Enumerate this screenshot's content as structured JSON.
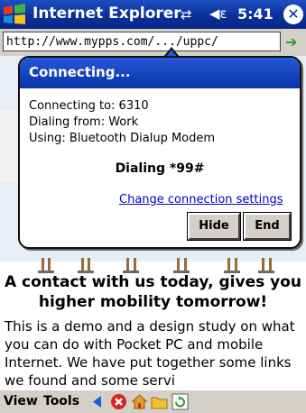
{
  "title_bar": {
    "app_title": "Internet Explorer",
    "clock": "5:41",
    "connectivity_glyph": "⇄",
    "volume_glyph": "◀ε",
    "close_glyph": "✕",
    "icons": [
      "windows-start-icon",
      "connectivity-icon",
      "volume-icon",
      "close-icon"
    ]
  },
  "address_bar": {
    "url": "http://www.mypps.com/.../uppc/"
  },
  "page": {
    "headline": "A contact with us today, gives you higher mobility tomorrow!",
    "body": "This is a demo and a design study on what you can do with Pocket PC and mobile Internet. We have put together some links we found and some servi"
  },
  "dialog": {
    "title": "Connecting...",
    "connecting_to": "Connecting to:   6310",
    "dialing_from": "Dialing from: Work",
    "using": "Using: Bluetooth Dialup Modem",
    "status": "Dialing *99#",
    "change_link": "Change connection settings",
    "hide_button": "Hide",
    "end_button": "End"
  },
  "toolbar": {
    "view_label": "View",
    "tools_label": "Tools",
    "icons": [
      "back-icon",
      "stop-icon",
      "home-icon",
      "favorites-icon",
      "refresh-icon"
    ]
  },
  "colors": {
    "title_bar": "#0a2f9a",
    "dialog_title": "#2458d8",
    "link": "#0000cc",
    "toolbar": "#d4d0c8"
  }
}
